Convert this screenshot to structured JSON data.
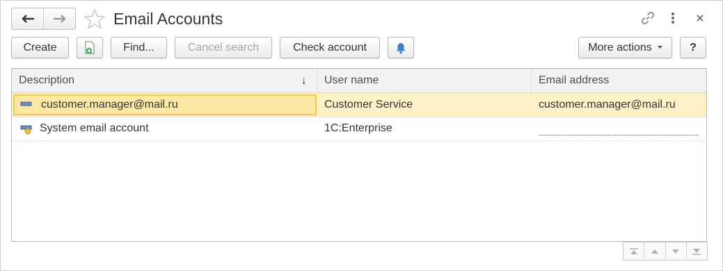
{
  "window": {
    "title": "Email Accounts"
  },
  "toolbar": {
    "create_label": "Create",
    "find_label": "Find...",
    "cancel_search_label": "Cancel search",
    "check_account_label": "Check account",
    "more_actions_label": "More actions",
    "help_label": "?"
  },
  "table": {
    "columns": [
      "Description",
      "User name",
      "Email address"
    ],
    "sorted_column": "Description",
    "rows": [
      {
        "description": "customer.manager@mail.ru",
        "user_name": "Customer Service",
        "email": "customer.manager@mail.ru",
        "selected": true
      },
      {
        "description": "System email account",
        "user_name": "1C:Enterprise",
        "email": "",
        "selected": false
      }
    ]
  },
  "icons": {
    "back": "arrow-left-icon",
    "forward": "arrow-right-icon",
    "favorite": "star-icon",
    "link": "link-icon",
    "menu": "more-vertical-icon",
    "close": "close-icon",
    "create_copy": "add-document-icon",
    "notifications": "bell-icon",
    "sort": "sort-down-icon"
  },
  "colors": {
    "selected_row": "#fbf0c6",
    "focused_cell_border": "#f2c94c",
    "header_bg": "#f2f2f2",
    "bell": "#3b7fc4"
  }
}
